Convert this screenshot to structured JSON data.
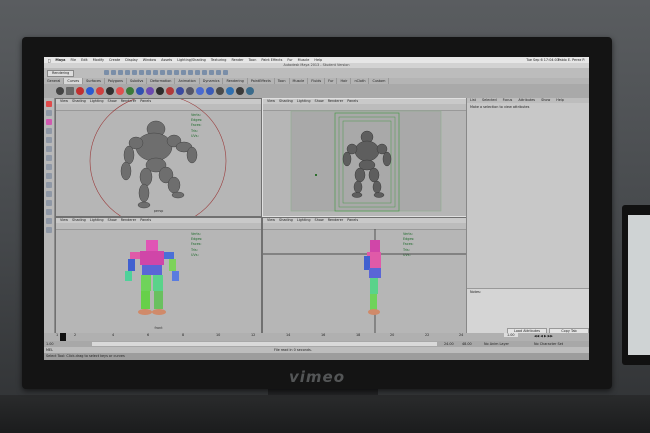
{
  "os_menubar": {
    "app": "Maya",
    "items": [
      "File",
      "Edit",
      "Modify",
      "Create",
      "Display",
      "Window",
      "Assets",
      "Lighting/Shading",
      "Texturing",
      "Render",
      "Toon",
      "Paint Effects",
      "Fur",
      "Muscle",
      "Help"
    ],
    "clock": "Tue Sep 6 17:04:03",
    "user": "Pablo E. Perez P."
  },
  "window": {
    "title": "Autodesk Maya 2013 - Student Version"
  },
  "menuset": "Rendering",
  "shelf_tabs": [
    "General",
    "Curves",
    "Surfaces",
    "Polygons",
    "Subdivs",
    "Deformation",
    "Animation",
    "Dynamics",
    "Rendering",
    "PaintEffects",
    "Toon",
    "Muscle",
    "Fluids",
    "Fur",
    "Hair",
    "nCloth",
    "Custom"
  ],
  "viewports": [
    {
      "id": "top-left",
      "menu": [
        "View",
        "Shading",
        "Lighting",
        "Show",
        "Renderer",
        "Panels"
      ],
      "stats": [
        "Verts:",
        "Edges:",
        "Faces:",
        "Tris:",
        "UVs:"
      ],
      "camera": "persp",
      "active": false
    },
    {
      "id": "top-right",
      "menu": [
        "View",
        "Shading",
        "Lighting",
        "Show",
        "Renderer",
        "Panels"
      ],
      "stats": [
        "Verts:",
        "Edges:",
        "Faces:",
        "Tris:",
        "UVs:"
      ],
      "camera": "",
      "active": true
    },
    {
      "id": "bottom-left",
      "menu": [
        "View",
        "Shading",
        "Lighting",
        "Show",
        "Renderer",
        "Panels"
      ],
      "stats": [
        "Verts:",
        "Edges:",
        "Faces:",
        "Tris:",
        "UVs:"
      ],
      "camera": "front",
      "active": false
    },
    {
      "id": "bottom-right",
      "menu": [
        "View",
        "Shading",
        "Lighting",
        "Show",
        "Renderer",
        "Panels"
      ],
      "stats": [
        "Verts:",
        "Edges:",
        "Faces:",
        "Tris:",
        "UVs:"
      ],
      "camera": "",
      "active": false
    }
  ],
  "attr_panel": {
    "tabs": [
      "List",
      "Selected",
      "Focus",
      "Attributes",
      "Show",
      "Help"
    ],
    "hint": "Make a selection to view attributes",
    "notes_label": "Notes:",
    "buttons": [
      "Load Attributes",
      "Copy Tab"
    ]
  },
  "timeline": {
    "ticks": [
      "1",
      "2",
      "4",
      "6",
      "8",
      "10",
      "12",
      "14",
      "16",
      "18",
      "20",
      "22",
      "24"
    ],
    "current_frame": "1.00"
  },
  "range": {
    "start": "1.00",
    "end": "24.00",
    "anim_end": "48.00",
    "char_set": "No Character Set",
    "anim_layer": "No Anim Layer"
  },
  "command_line": {
    "label": "MEL",
    "result": "File read in 0 seconds."
  },
  "help_line": "Select Tool: Click-drag to select keys or curves",
  "bezel_logo": "vimeo",
  "colors": {
    "viewport_bg": "#b6b6b6",
    "stats_text": "#1f6b2c",
    "robot_grey": "#6e6e6e"
  }
}
